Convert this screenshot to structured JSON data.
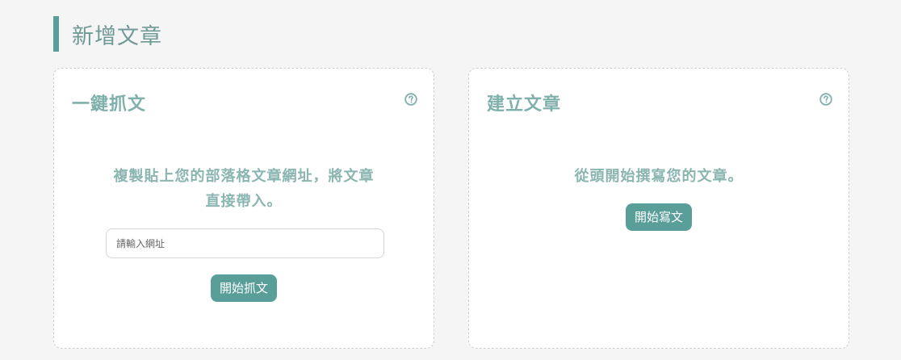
{
  "header": {
    "title": "新增文章"
  },
  "import_card": {
    "title": "一鍵抓文",
    "description": "複製貼上您的部落格文章網址，將文章直接帶入。",
    "url_placeholder": "請輸入網址",
    "button_label": "開始抓文",
    "help_icon": "question-circle-icon"
  },
  "create_card": {
    "title": "建立文章",
    "description": "從頭開始撰寫您的文章。",
    "button_label": "開始寫文",
    "help_icon": "question-circle-icon"
  },
  "colors": {
    "accent": "#5a9e9a",
    "title_text": "#7fb0ab",
    "background": "#f5f5f5"
  }
}
